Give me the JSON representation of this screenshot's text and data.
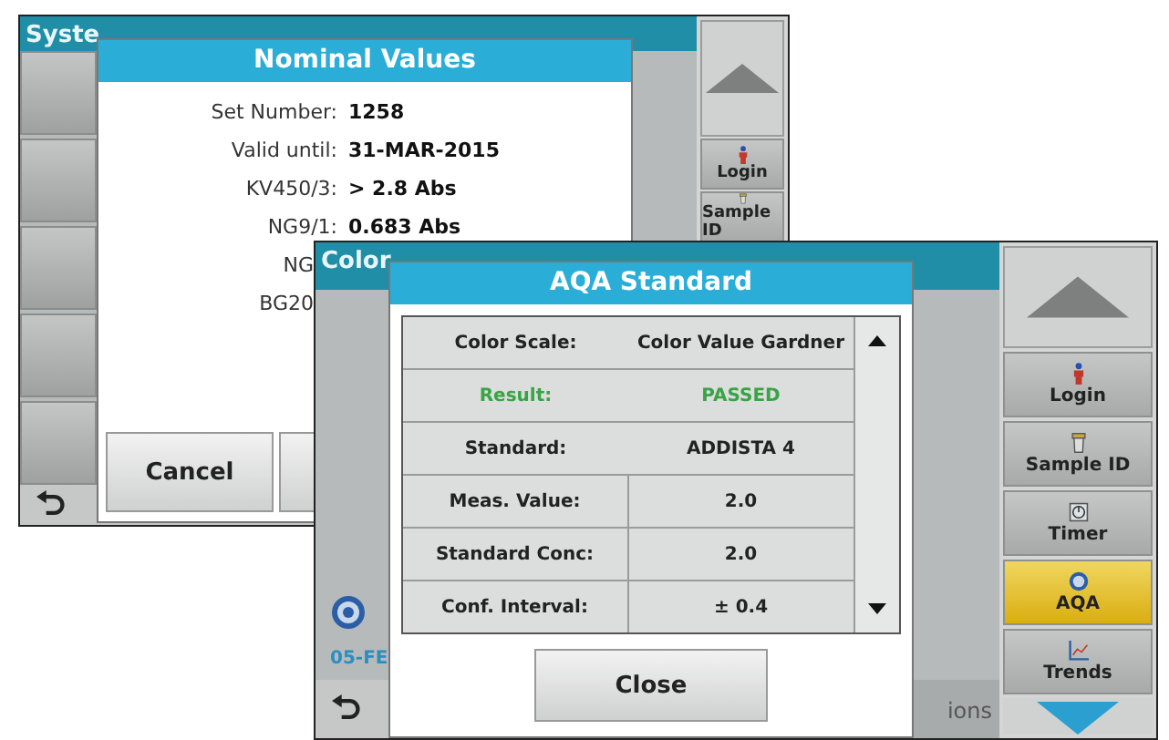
{
  "system_checks_screen": {
    "title": "Syste",
    "dialog": {
      "title": "Nominal Values",
      "rows": [
        {
          "kind": "full",
          "label": "Set Number:",
          "value": "1258"
        },
        {
          "kind": "full",
          "label": "Valid until:",
          "value": "31-MAR-2015"
        },
        {
          "kind": "full",
          "label": "KV450/3:",
          "value": "> 2.8 Abs"
        },
        {
          "kind": "full",
          "label": "NG9/1:",
          "value": "0.683 Abs"
        },
        {
          "kind": "cut",
          "label": "NG"
        },
        {
          "kind": "cut",
          "label": "BG20"
        }
      ],
      "cancel_button": "Cancel"
    },
    "sidebar": [
      {
        "kind": "person",
        "label": "Login"
      },
      {
        "kind": "cup",
        "label": "Sample ID"
      }
    ]
  },
  "color_measurement_screen": {
    "title": "Color",
    "date": "05-FE",
    "bottom_tab": "ions",
    "dialog": {
      "title": "AQA Standard",
      "rows": [
        {
          "kind": "plain",
          "label": "Color Scale:",
          "value": "Color Value Gardner"
        },
        {
          "kind": "result",
          "label": "Result:",
          "value": "PASSED"
        },
        {
          "kind": "plain",
          "label": "Standard:",
          "value": "ADDISTA 4"
        },
        {
          "kind": "split",
          "label": "Meas. Value:",
          "value": "2.0"
        },
        {
          "kind": "split",
          "label": "Standard Conc:",
          "value": "2.0"
        },
        {
          "kind": "split",
          "label": "Conf. Interval:",
          "value": "±  0.4"
        }
      ],
      "close_button": "Close"
    },
    "sidebar": [
      {
        "kind": "person",
        "label": "Login",
        "selected": false
      },
      {
        "kind": "cup",
        "label": "Sample ID",
        "selected": false
      },
      {
        "kind": "timer",
        "label": "Timer",
        "selected": false
      },
      {
        "kind": "globe",
        "label": "AQA",
        "selected": true
      },
      {
        "kind": "chart",
        "label": "Trends",
        "selected": false
      }
    ]
  }
}
